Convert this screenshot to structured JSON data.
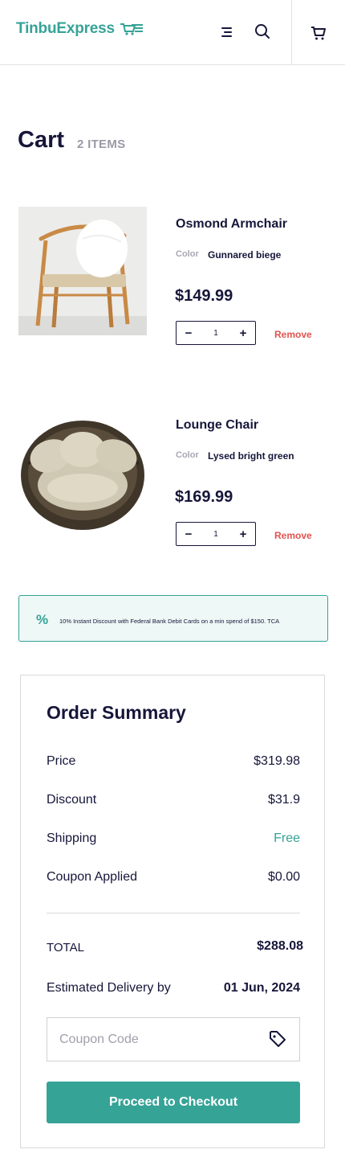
{
  "header": {
    "brand": "TinbuExpress",
    "icons": {
      "logo": "cart-speed-icon",
      "menu": "menu-icon",
      "search": "search-icon",
      "cart": "cart-icon"
    }
  },
  "cart": {
    "title": "Cart",
    "count_label": "2 ITEMS",
    "items": [
      {
        "name": "Osmond Armchair",
        "color_label": "Color",
        "color": "Gunnared biege",
        "price": "$149.99",
        "quantity": "1",
        "decrement": "−",
        "increment": "+",
        "remove_label": "Remove"
      },
      {
        "name": "Lounge Chair",
        "color_label": "Color",
        "color": "Lysed bright green",
        "price": "$169.99",
        "quantity": "1",
        "decrement": "−",
        "increment": "+",
        "remove_label": "Remove"
      }
    ]
  },
  "promo": {
    "icon": "%",
    "text": "10% Instant Discount with Federal Bank Debit Cards on a min spend of $150. TCA"
  },
  "summary": {
    "title": "Order Summary",
    "price_label": "Price",
    "price_value": "$319.98",
    "discount_label": "Discount",
    "discount_value": "$31.9",
    "shipping_label": "Shipping",
    "shipping_value": "Free",
    "coupon_label": "Coupon Applied",
    "coupon_value": "$0.00",
    "total_label": "TOTAL",
    "total_value": "$288.08",
    "delivery_label": "Estimated Delivery by",
    "delivery_value": "01 Jun, 2024",
    "coupon_placeholder": "Coupon Code",
    "checkout_label": "Proceed to Checkout"
  },
  "colors": {
    "brand": "#36a397",
    "text": "#16163a",
    "remove": "#e0534f",
    "promo_bg": "#eef8f6"
  }
}
